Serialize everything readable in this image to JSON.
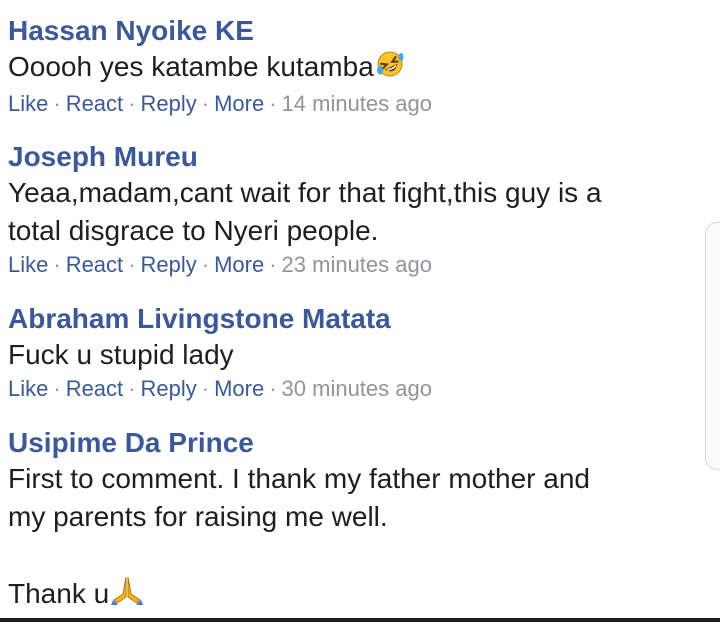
{
  "comments": [
    {
      "author": "Hassan Nyoike KE",
      "lines": [
        "Ooooh yes katambe kutamba"
      ],
      "emoji": "rolling-on-floor-laughing",
      "actions": [
        "Like",
        "React",
        "Reply",
        "More"
      ],
      "time": "14 minutes ago"
    },
    {
      "author": "Joseph Mureu",
      "lines": [
        "Yeaa,madam,cant wait for that fight,this guy is a",
        "total disgrace to Nyeri people."
      ],
      "actions": [
        "Like",
        "React",
        "Reply",
        "More"
      ],
      "time": "23 minutes ago"
    },
    {
      "author": "Abraham Livingstone Matata",
      "lines": [
        "Fuck u stupid lady"
      ],
      "actions": [
        "Like",
        "React",
        "Reply",
        "More"
      ],
      "time": "30 minutes ago"
    },
    {
      "author": "Usipime Da Prince",
      "lines": [
        "First to comment. I thank my father mother and",
        "my parents for raising me well.",
        "",
        "Thank u"
      ],
      "emoji": "folded-hands"
    }
  ],
  "colors": {
    "link": "#3b5998",
    "meta": "#90949c",
    "text": "#1c1e21"
  }
}
